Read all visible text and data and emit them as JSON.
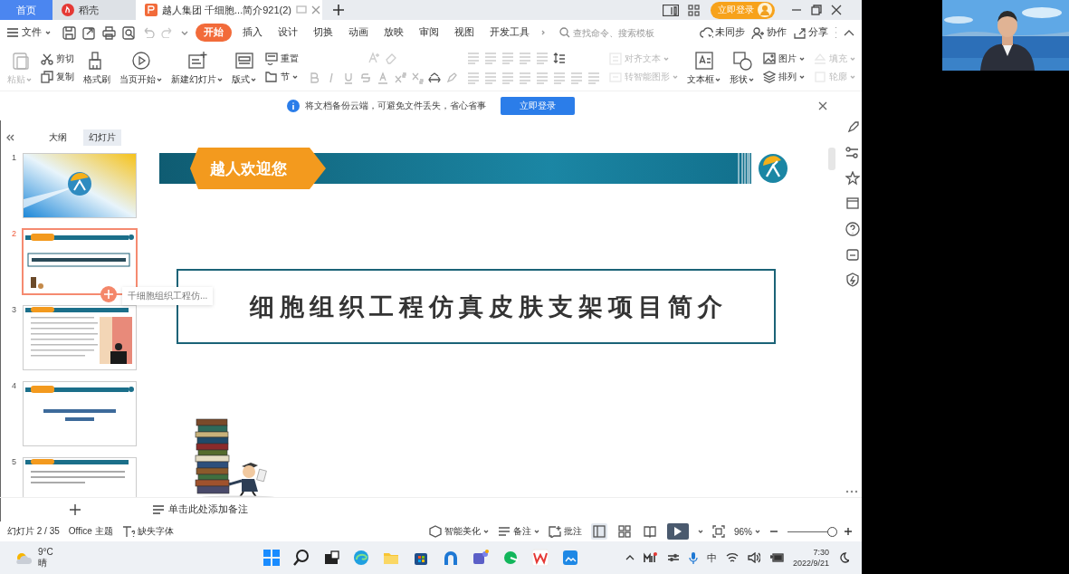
{
  "tabs": [
    {
      "label": "首页",
      "kind": "home",
      "selected": false
    },
    {
      "label": "稻壳",
      "kind": "app",
      "selected": false
    },
    {
      "label": "越人集团 千细胞...简介921(2)",
      "kind": "document",
      "selected": true
    }
  ],
  "account_button": "立即登录",
  "menu": {
    "file": "文件",
    "tabs": [
      {
        "label": "开始",
        "selected": true
      },
      {
        "label": "插入",
        "selected": false
      },
      {
        "label": "设计",
        "selected": false
      },
      {
        "label": "切换",
        "selected": false
      },
      {
        "label": "动画",
        "selected": false
      },
      {
        "label": "放映",
        "selected": false
      },
      {
        "label": "审阅",
        "selected": false
      },
      {
        "label": "视图",
        "selected": false
      },
      {
        "label": "开发工具",
        "selected": false
      }
    ],
    "search": {
      "placeholder": "查找命令、搜索模板"
    },
    "actions": [
      "未同步",
      "协作",
      "分享"
    ]
  },
  "ribbon": [
    {
      "kind": "large",
      "items": [
        {
          "label": "粘贴",
          "disabled": true,
          "menu": true
        }
      ]
    },
    {
      "kind": "stack",
      "items": [
        {
          "label": "剪切",
          "disabled": false,
          "menu": false
        },
        {
          "label": "复制",
          "disabled": false,
          "menu": false
        }
      ]
    },
    {
      "kind": "large",
      "items": [
        {
          "label": "格式刷",
          "disabled": false,
          "menu": false
        }
      ]
    },
    {
      "kind": "large",
      "items": [
        {
          "label": "当页开始",
          "disabled": false,
          "menu": true
        }
      ]
    },
    {
      "kind": "large",
      "items": [
        {
          "label": "新建幻灯片",
          "disabled": false,
          "menu": true
        }
      ]
    },
    {
      "kind": "large",
      "items": [
        {
          "label": "版式",
          "disabled": false,
          "menu": true
        }
      ]
    },
    {
      "kind": "stack",
      "items": [
        {
          "label": "重置",
          "disabled": false,
          "menu": false
        },
        {
          "label": "节",
          "disabled": false,
          "menu": true
        }
      ]
    },
    {
      "kind": "font"
    },
    {
      "kind": "paragraph"
    },
    {
      "kind": "stack",
      "items": [
        {
          "label": "对齐文本",
          "disabled": true,
          "menu": true
        },
        {
          "label": "转智能图形",
          "disabled": true,
          "menu": true
        }
      ]
    },
    {
      "kind": "large",
      "items": [
        {
          "label": "文本框",
          "disabled": false,
          "menu": true
        }
      ]
    },
    {
      "kind": "large",
      "items": [
        {
          "label": "形状",
          "disabled": false,
          "menu": true
        }
      ]
    },
    {
      "kind": "stack",
      "items": [
        {
          "label": "图片",
          "disabled": false,
          "menu": true
        },
        {
          "label": "排列",
          "disabled": false,
          "menu": true
        }
      ]
    },
    {
      "kind": "stack",
      "items": [
        {
          "label": "填充",
          "disabled": true,
          "menu": true
        },
        {
          "label": "轮廓",
          "disabled": true,
          "menu": true
        }
      ]
    }
  ],
  "notice": {
    "text": "将文档备份云端，可避免文件丢失，省心省事",
    "button": "立即登录"
  },
  "panel": {
    "tabs": [
      {
        "label": "大纲",
        "selected": false
      },
      {
        "label": "幻灯片",
        "selected": true
      }
    ],
    "slides": [
      {
        "number": "1",
        "selected": false
      },
      {
        "number": "2",
        "selected": true
      },
      {
        "number": "3",
        "selected": false
      },
      {
        "number": "4",
        "selected": false
      },
      {
        "number": "5",
        "selected": false
      }
    ],
    "tooltip": "千细胞组织工程仿..."
  },
  "slide": {
    "banner": "越人欢迎您",
    "title": "细胞组织工程仿真皮肤支架项目简介"
  },
  "notes_placeholder": "单击此处添加备注",
  "status_bar": {
    "slide": "幻灯片 2 / 35",
    "theme": "Office 主题",
    "fonts": "缺失字体",
    "beautify": "智能美化",
    "notes": "备注",
    "comments": "批注",
    "views": [
      {
        "selected": true
      },
      {
        "selected": false
      },
      {
        "selected": false
      }
    ],
    "zoom": "96%",
    "zoom_slider": {
      "level": 0.95
    }
  },
  "taskbar": {
    "temperature": "9°C",
    "weather": "晴",
    "ime": "中",
    "time": "7:30",
    "date": "2022/9/21"
  }
}
